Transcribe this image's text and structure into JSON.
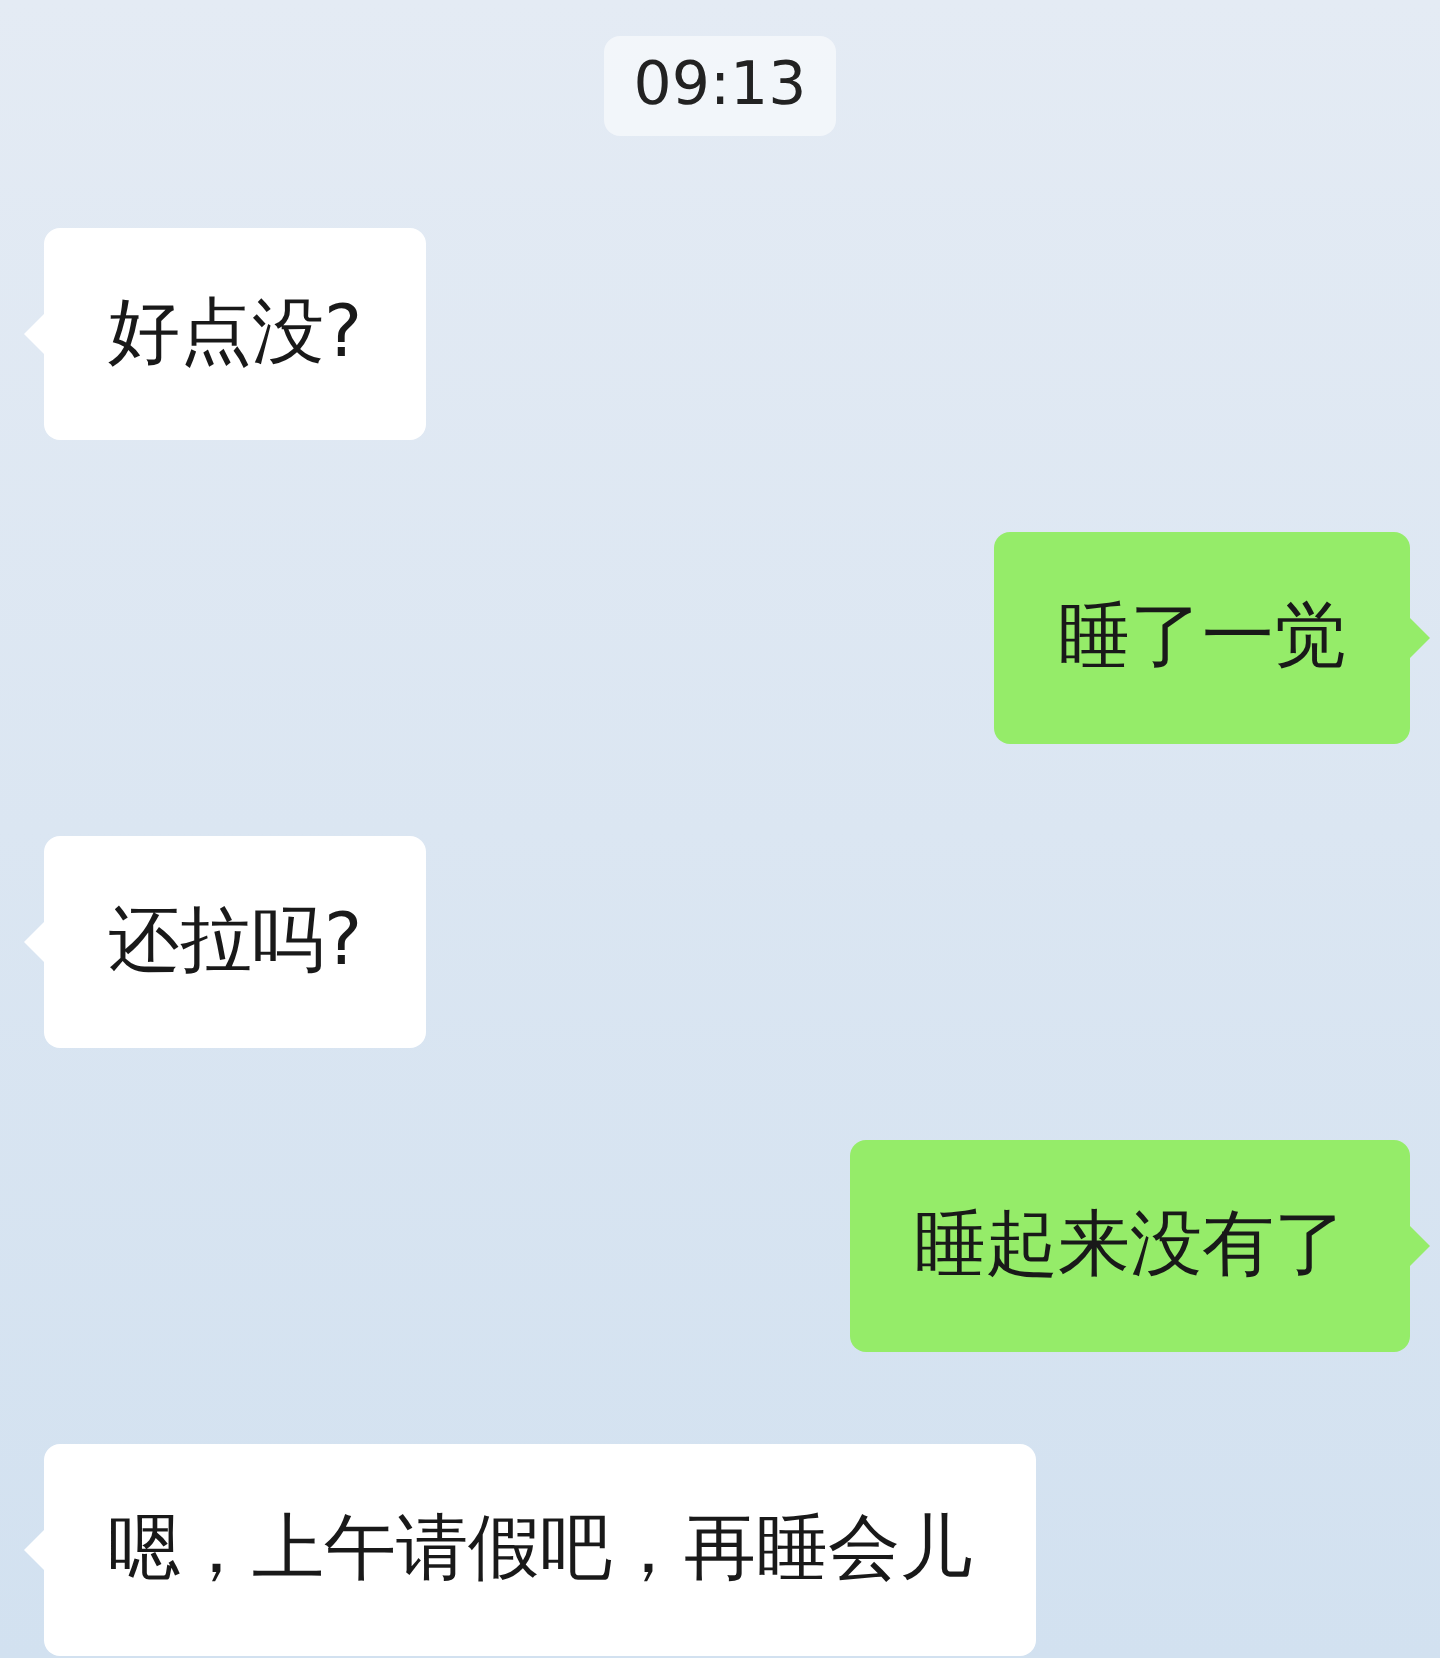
{
  "timestamp": "09:13",
  "messages": [
    {
      "kind": "incoming",
      "text": "好点没?"
    },
    {
      "kind": "outgoing",
      "text": "睡了一觉"
    },
    {
      "kind": "incoming",
      "text": "还拉吗?"
    },
    {
      "kind": "outgoing",
      "text": "睡起来没有了"
    },
    {
      "kind": "incoming",
      "text": "嗯，上午请假吧，再睡会儿"
    }
  ]
}
